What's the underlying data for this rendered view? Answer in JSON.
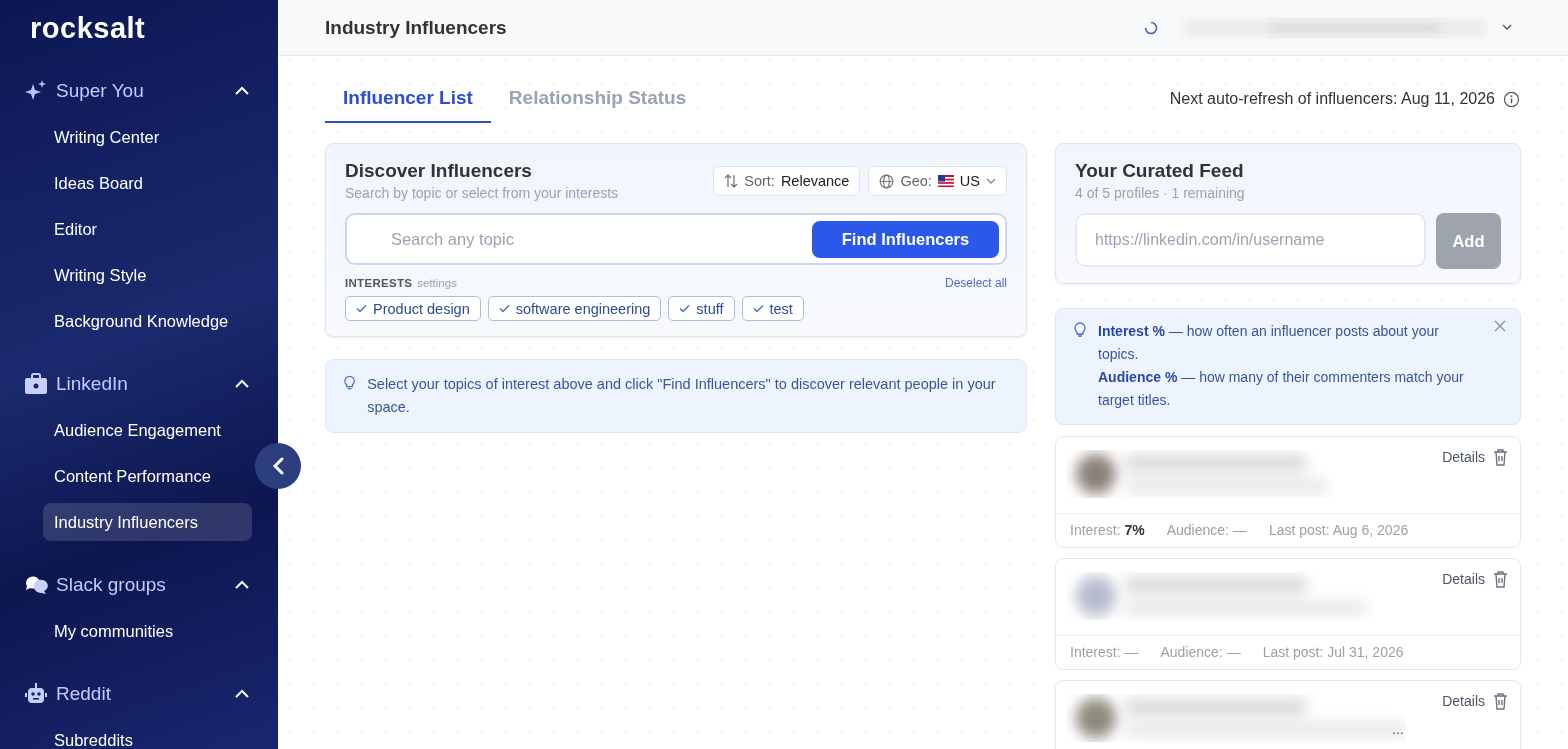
{
  "brand": "rocksalt",
  "sidebar": {
    "sections": [
      {
        "title": "Super You",
        "kind": "sparkle",
        "expanded": true,
        "items": [
          {
            "label": "Writing Center",
            "selected": false
          },
          {
            "label": "Ideas Board",
            "selected": false
          },
          {
            "label": "Editor",
            "selected": false
          },
          {
            "label": "Writing Style",
            "selected": false
          },
          {
            "label": "Background Knowledge",
            "selected": false
          }
        ]
      },
      {
        "title": "LinkedIn",
        "kind": "briefcase",
        "expanded": true,
        "items": [
          {
            "label": "Audience Engagement",
            "selected": false
          },
          {
            "label": "Content Performance",
            "selected": false
          },
          {
            "label": "Industry Influencers",
            "selected": true
          }
        ]
      },
      {
        "title": "Slack groups",
        "kind": "chat",
        "expanded": true,
        "items": [
          {
            "label": "My communities",
            "selected": false
          }
        ]
      },
      {
        "title": "Reddit",
        "kind": "robot",
        "expanded": true,
        "items": [
          {
            "label": "Subreddits",
            "selected": false
          }
        ]
      }
    ]
  },
  "header": {
    "title": "Industry Influencers"
  },
  "tabs": [
    {
      "label": "Influencer List",
      "selected": true
    },
    {
      "label": "Relationship Status",
      "selected": false
    }
  ],
  "refresh_note": "Next auto-refresh of influencers: Aug 11, 2026",
  "discover": {
    "title": "Discover Influencers",
    "subtitle": "Search by topic or select from your interests",
    "sort_label": "Sort:",
    "sort_value": "Relevance",
    "geo_label": "Geo:",
    "geo_value": "US",
    "search": {
      "placeholder": "Search any topic"
    },
    "button": "Find Influencers",
    "interests_label": "INTERESTS",
    "settings_link": "settings",
    "deselect": "Deselect all",
    "interests": [
      {
        "label": "Product design",
        "selected": true
      },
      {
        "label": "software engineering",
        "selected": true
      },
      {
        "label": "stuff",
        "selected": true
      },
      {
        "label": "test",
        "selected": true
      }
    ]
  },
  "hint": "Select your topics of interest above and click \"Find Influencers\" to discover relevant people in your space.",
  "feed": {
    "title": "Your Curated Feed",
    "subtitle": "4 of 5 profiles · 1 remaining",
    "url_field": {
      "placeholder": "https://linkedin.com/in/username"
    },
    "add_button": {
      "label": "Add",
      "disabled": true
    }
  },
  "legend": [
    "**Interest %** — how often an influencer posts about your topics.",
    "**Audience %** — how many of their commenters match your target titles."
  ],
  "profiles": [
    {
      "details": "Details",
      "stats": [
        "Interest: **7%**",
        "Audience: —",
        "Last post: Aug 6, 2026"
      ]
    },
    {
      "details": "Details",
      "stats": [
        "Interest: —",
        "Audience: —",
        "Last post: Jul 31, 2026"
      ]
    },
    {
      "details": "Details",
      "more": "..."
    }
  ]
}
